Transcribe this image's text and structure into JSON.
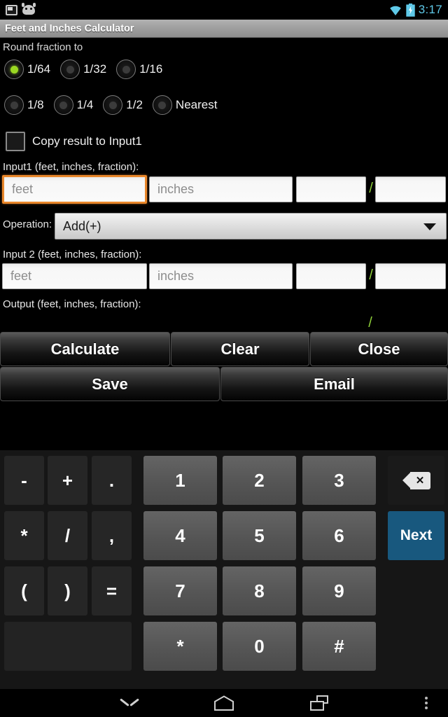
{
  "statusbar": {
    "time": "3:17",
    "icons": [
      "screen-notification-icon",
      "android-notification-icon",
      "wifi-icon",
      "battery-charging-icon"
    ]
  },
  "titlebar": {
    "title": "Feet and Inches Calculator"
  },
  "form": {
    "round_label": "Round fraction to",
    "round_options": [
      {
        "label": "1/64",
        "selected": true
      },
      {
        "label": "1/32",
        "selected": false
      },
      {
        "label": "1/16",
        "selected": false
      },
      {
        "label": "1/8",
        "selected": false
      },
      {
        "label": "1/4",
        "selected": false
      },
      {
        "label": "1/2",
        "selected": false
      },
      {
        "label": "Nearest",
        "selected": false
      }
    ],
    "copy_checkbox": {
      "label": "Copy result to Input1",
      "checked": false
    },
    "input1": {
      "label": "Input1 (feet, inches, fraction):",
      "feet_placeholder": "feet",
      "feet_value": "",
      "inches_placeholder": "inches",
      "inches_value": "",
      "numerator_value": "",
      "denominator_value": "",
      "separator": "/"
    },
    "operation": {
      "label": "Operation:",
      "value": "Add(+)"
    },
    "input2": {
      "label": "Input 2 (feet, inches, fraction):",
      "feet_placeholder": "feet",
      "feet_value": "",
      "inches_placeholder": "inches",
      "inches_value": "",
      "numerator_value": "",
      "denominator_value": "",
      "separator": "/"
    },
    "output": {
      "label": "Output (feet, inches, fraction):",
      "feet_value": "",
      "inches_value": "",
      "numerator_value": "",
      "denominator_value": "",
      "separator": "/"
    },
    "buttons": {
      "calculate": "Calculate",
      "clear": "Clear",
      "close": "Close",
      "save": "Save",
      "email": "Email"
    }
  },
  "keyboard": {
    "keys": {
      "minus": "-",
      "plus": "+",
      "dot": ".",
      "star": "*",
      "slash": "/",
      "comma": ",",
      "lparen": "(",
      "rparen": ")",
      "equals": "=",
      "blank": "",
      "k1": "1",
      "k2": "2",
      "k3": "3",
      "k4": "4",
      "k5": "5",
      "k6": "6",
      "k7": "7",
      "k8": "8",
      "k9": "9",
      "kstar": "*",
      "k0": "0",
      "khash": "#",
      "next": "Next",
      "backspace": "backspace-icon"
    },
    "accent_color": "#18587e"
  },
  "navbar": {
    "items": [
      "hide-keyboard-icon",
      "home-icon",
      "recents-icon",
      "overflow-menu-icon"
    ]
  },
  "colors": {
    "accent_green": "#9ad822",
    "focus_orange": "#e8862a",
    "status_blue": "#5fc9e8",
    "next_blue": "#18587e"
  }
}
